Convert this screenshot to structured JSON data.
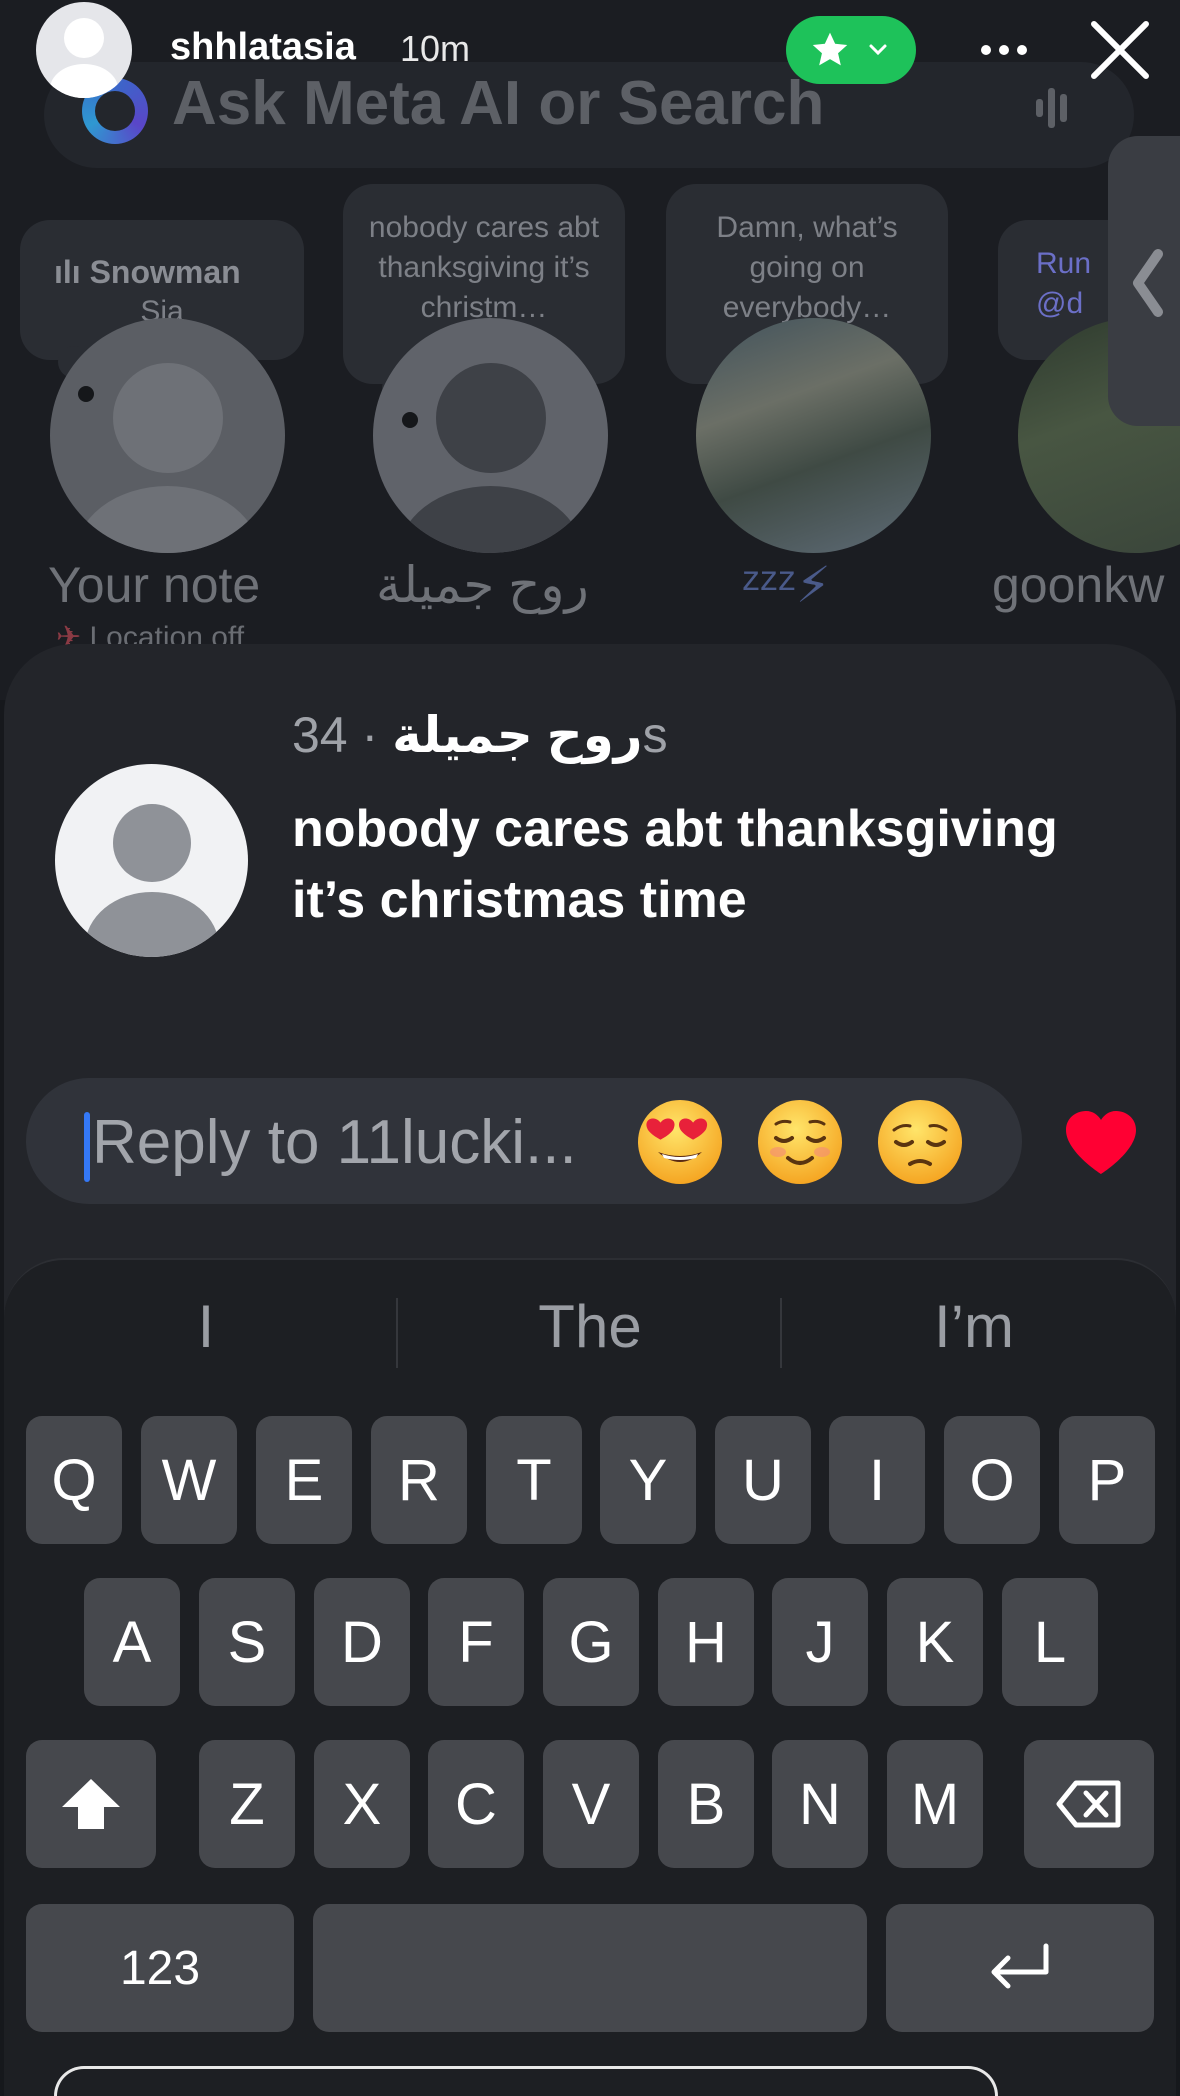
{
  "story": {
    "username": "shhlatasia",
    "time_ago": "10m",
    "close_friends_icon": "star-icon",
    "more_icon": "more-horizontal-icon",
    "close_icon": "close-icon"
  },
  "background": {
    "search_placeholder": "Ask Meta AI or Search",
    "notes": [
      {
        "note_text": "",
        "music_title": "Snowman",
        "music_artist": "Sia",
        "label": "Your note",
        "sublabel": "Location off"
      },
      {
        "note_text": "nobody cares abt thanksgiving it’s christm…",
        "label": "روح جميلة"
      },
      {
        "note_text": "Damn, what’s going on everybody…",
        "label": "ᶻᶻᶻ⚡"
      },
      {
        "note_text": "Run @d",
        "label": "goonkw"
      }
    ]
  },
  "reply_sheet": {
    "sender_name": "روح جميلة",
    "separator": " · ",
    "sender_time": "34s",
    "note_text": "nobody cares abt thanksgiving it’s christmas time",
    "reply_placeholder": "Reply to 11lucki...",
    "quick_reactions": [
      "heart-eyes-emoji",
      "relieved-emoji",
      "pensive-emoji"
    ],
    "like_icon": "heart-icon",
    "like_color": "#ff0033"
  },
  "keyboard": {
    "suggestions": [
      "I",
      "The",
      "I’m"
    ],
    "row1": [
      "Q",
      "W",
      "E",
      "R",
      "T",
      "Y",
      "U",
      "I",
      "O",
      "P"
    ],
    "row2": [
      "A",
      "S",
      "D",
      "F",
      "G",
      "H",
      "J",
      "K",
      "L"
    ],
    "row3": [
      "Z",
      "X",
      "C",
      "V",
      "B",
      "N",
      "M"
    ],
    "numbers_key": "123",
    "shift_icon": "shift-icon",
    "delete_icon": "backspace-icon",
    "return_icon": "return-icon"
  },
  "colors": {
    "accent": "#3478f6",
    "close_friends": "#1ec25a"
  }
}
